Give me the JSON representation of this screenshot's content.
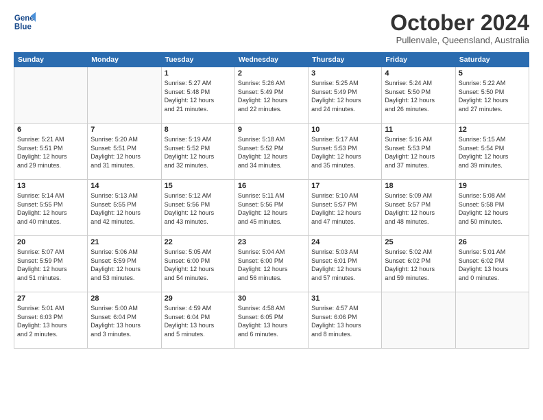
{
  "header": {
    "logo_line1": "General",
    "logo_line2": "Blue",
    "month": "October 2024",
    "location": "Pullenvale, Queensland, Australia"
  },
  "weekdays": [
    "Sunday",
    "Monday",
    "Tuesday",
    "Wednesday",
    "Thursday",
    "Friday",
    "Saturday"
  ],
  "weeks": [
    [
      {
        "day": "",
        "info": ""
      },
      {
        "day": "",
        "info": ""
      },
      {
        "day": "1",
        "info": "Sunrise: 5:27 AM\nSunset: 5:48 PM\nDaylight: 12 hours\nand 21 minutes."
      },
      {
        "day": "2",
        "info": "Sunrise: 5:26 AM\nSunset: 5:49 PM\nDaylight: 12 hours\nand 22 minutes."
      },
      {
        "day": "3",
        "info": "Sunrise: 5:25 AM\nSunset: 5:49 PM\nDaylight: 12 hours\nand 24 minutes."
      },
      {
        "day": "4",
        "info": "Sunrise: 5:24 AM\nSunset: 5:50 PM\nDaylight: 12 hours\nand 26 minutes."
      },
      {
        "day": "5",
        "info": "Sunrise: 5:22 AM\nSunset: 5:50 PM\nDaylight: 12 hours\nand 27 minutes."
      }
    ],
    [
      {
        "day": "6",
        "info": "Sunrise: 5:21 AM\nSunset: 5:51 PM\nDaylight: 12 hours\nand 29 minutes."
      },
      {
        "day": "7",
        "info": "Sunrise: 5:20 AM\nSunset: 5:51 PM\nDaylight: 12 hours\nand 31 minutes."
      },
      {
        "day": "8",
        "info": "Sunrise: 5:19 AM\nSunset: 5:52 PM\nDaylight: 12 hours\nand 32 minutes."
      },
      {
        "day": "9",
        "info": "Sunrise: 5:18 AM\nSunset: 5:52 PM\nDaylight: 12 hours\nand 34 minutes."
      },
      {
        "day": "10",
        "info": "Sunrise: 5:17 AM\nSunset: 5:53 PM\nDaylight: 12 hours\nand 35 minutes."
      },
      {
        "day": "11",
        "info": "Sunrise: 5:16 AM\nSunset: 5:53 PM\nDaylight: 12 hours\nand 37 minutes."
      },
      {
        "day": "12",
        "info": "Sunrise: 5:15 AM\nSunset: 5:54 PM\nDaylight: 12 hours\nand 39 minutes."
      }
    ],
    [
      {
        "day": "13",
        "info": "Sunrise: 5:14 AM\nSunset: 5:55 PM\nDaylight: 12 hours\nand 40 minutes."
      },
      {
        "day": "14",
        "info": "Sunrise: 5:13 AM\nSunset: 5:55 PM\nDaylight: 12 hours\nand 42 minutes."
      },
      {
        "day": "15",
        "info": "Sunrise: 5:12 AM\nSunset: 5:56 PM\nDaylight: 12 hours\nand 43 minutes."
      },
      {
        "day": "16",
        "info": "Sunrise: 5:11 AM\nSunset: 5:56 PM\nDaylight: 12 hours\nand 45 minutes."
      },
      {
        "day": "17",
        "info": "Sunrise: 5:10 AM\nSunset: 5:57 PM\nDaylight: 12 hours\nand 47 minutes."
      },
      {
        "day": "18",
        "info": "Sunrise: 5:09 AM\nSunset: 5:57 PM\nDaylight: 12 hours\nand 48 minutes."
      },
      {
        "day": "19",
        "info": "Sunrise: 5:08 AM\nSunset: 5:58 PM\nDaylight: 12 hours\nand 50 minutes."
      }
    ],
    [
      {
        "day": "20",
        "info": "Sunrise: 5:07 AM\nSunset: 5:59 PM\nDaylight: 12 hours\nand 51 minutes."
      },
      {
        "day": "21",
        "info": "Sunrise: 5:06 AM\nSunset: 5:59 PM\nDaylight: 12 hours\nand 53 minutes."
      },
      {
        "day": "22",
        "info": "Sunrise: 5:05 AM\nSunset: 6:00 PM\nDaylight: 12 hours\nand 54 minutes."
      },
      {
        "day": "23",
        "info": "Sunrise: 5:04 AM\nSunset: 6:00 PM\nDaylight: 12 hours\nand 56 minutes."
      },
      {
        "day": "24",
        "info": "Sunrise: 5:03 AM\nSunset: 6:01 PM\nDaylight: 12 hours\nand 57 minutes."
      },
      {
        "day": "25",
        "info": "Sunrise: 5:02 AM\nSunset: 6:02 PM\nDaylight: 12 hours\nand 59 minutes."
      },
      {
        "day": "26",
        "info": "Sunrise: 5:01 AM\nSunset: 6:02 PM\nDaylight: 13 hours\nand 0 minutes."
      }
    ],
    [
      {
        "day": "27",
        "info": "Sunrise: 5:01 AM\nSunset: 6:03 PM\nDaylight: 13 hours\nand 2 minutes."
      },
      {
        "day": "28",
        "info": "Sunrise: 5:00 AM\nSunset: 6:04 PM\nDaylight: 13 hours\nand 3 minutes."
      },
      {
        "day": "29",
        "info": "Sunrise: 4:59 AM\nSunset: 6:04 PM\nDaylight: 13 hours\nand 5 minutes."
      },
      {
        "day": "30",
        "info": "Sunrise: 4:58 AM\nSunset: 6:05 PM\nDaylight: 13 hours\nand 6 minutes."
      },
      {
        "day": "31",
        "info": "Sunrise: 4:57 AM\nSunset: 6:06 PM\nDaylight: 13 hours\nand 8 minutes."
      },
      {
        "day": "",
        "info": ""
      },
      {
        "day": "",
        "info": ""
      }
    ]
  ]
}
